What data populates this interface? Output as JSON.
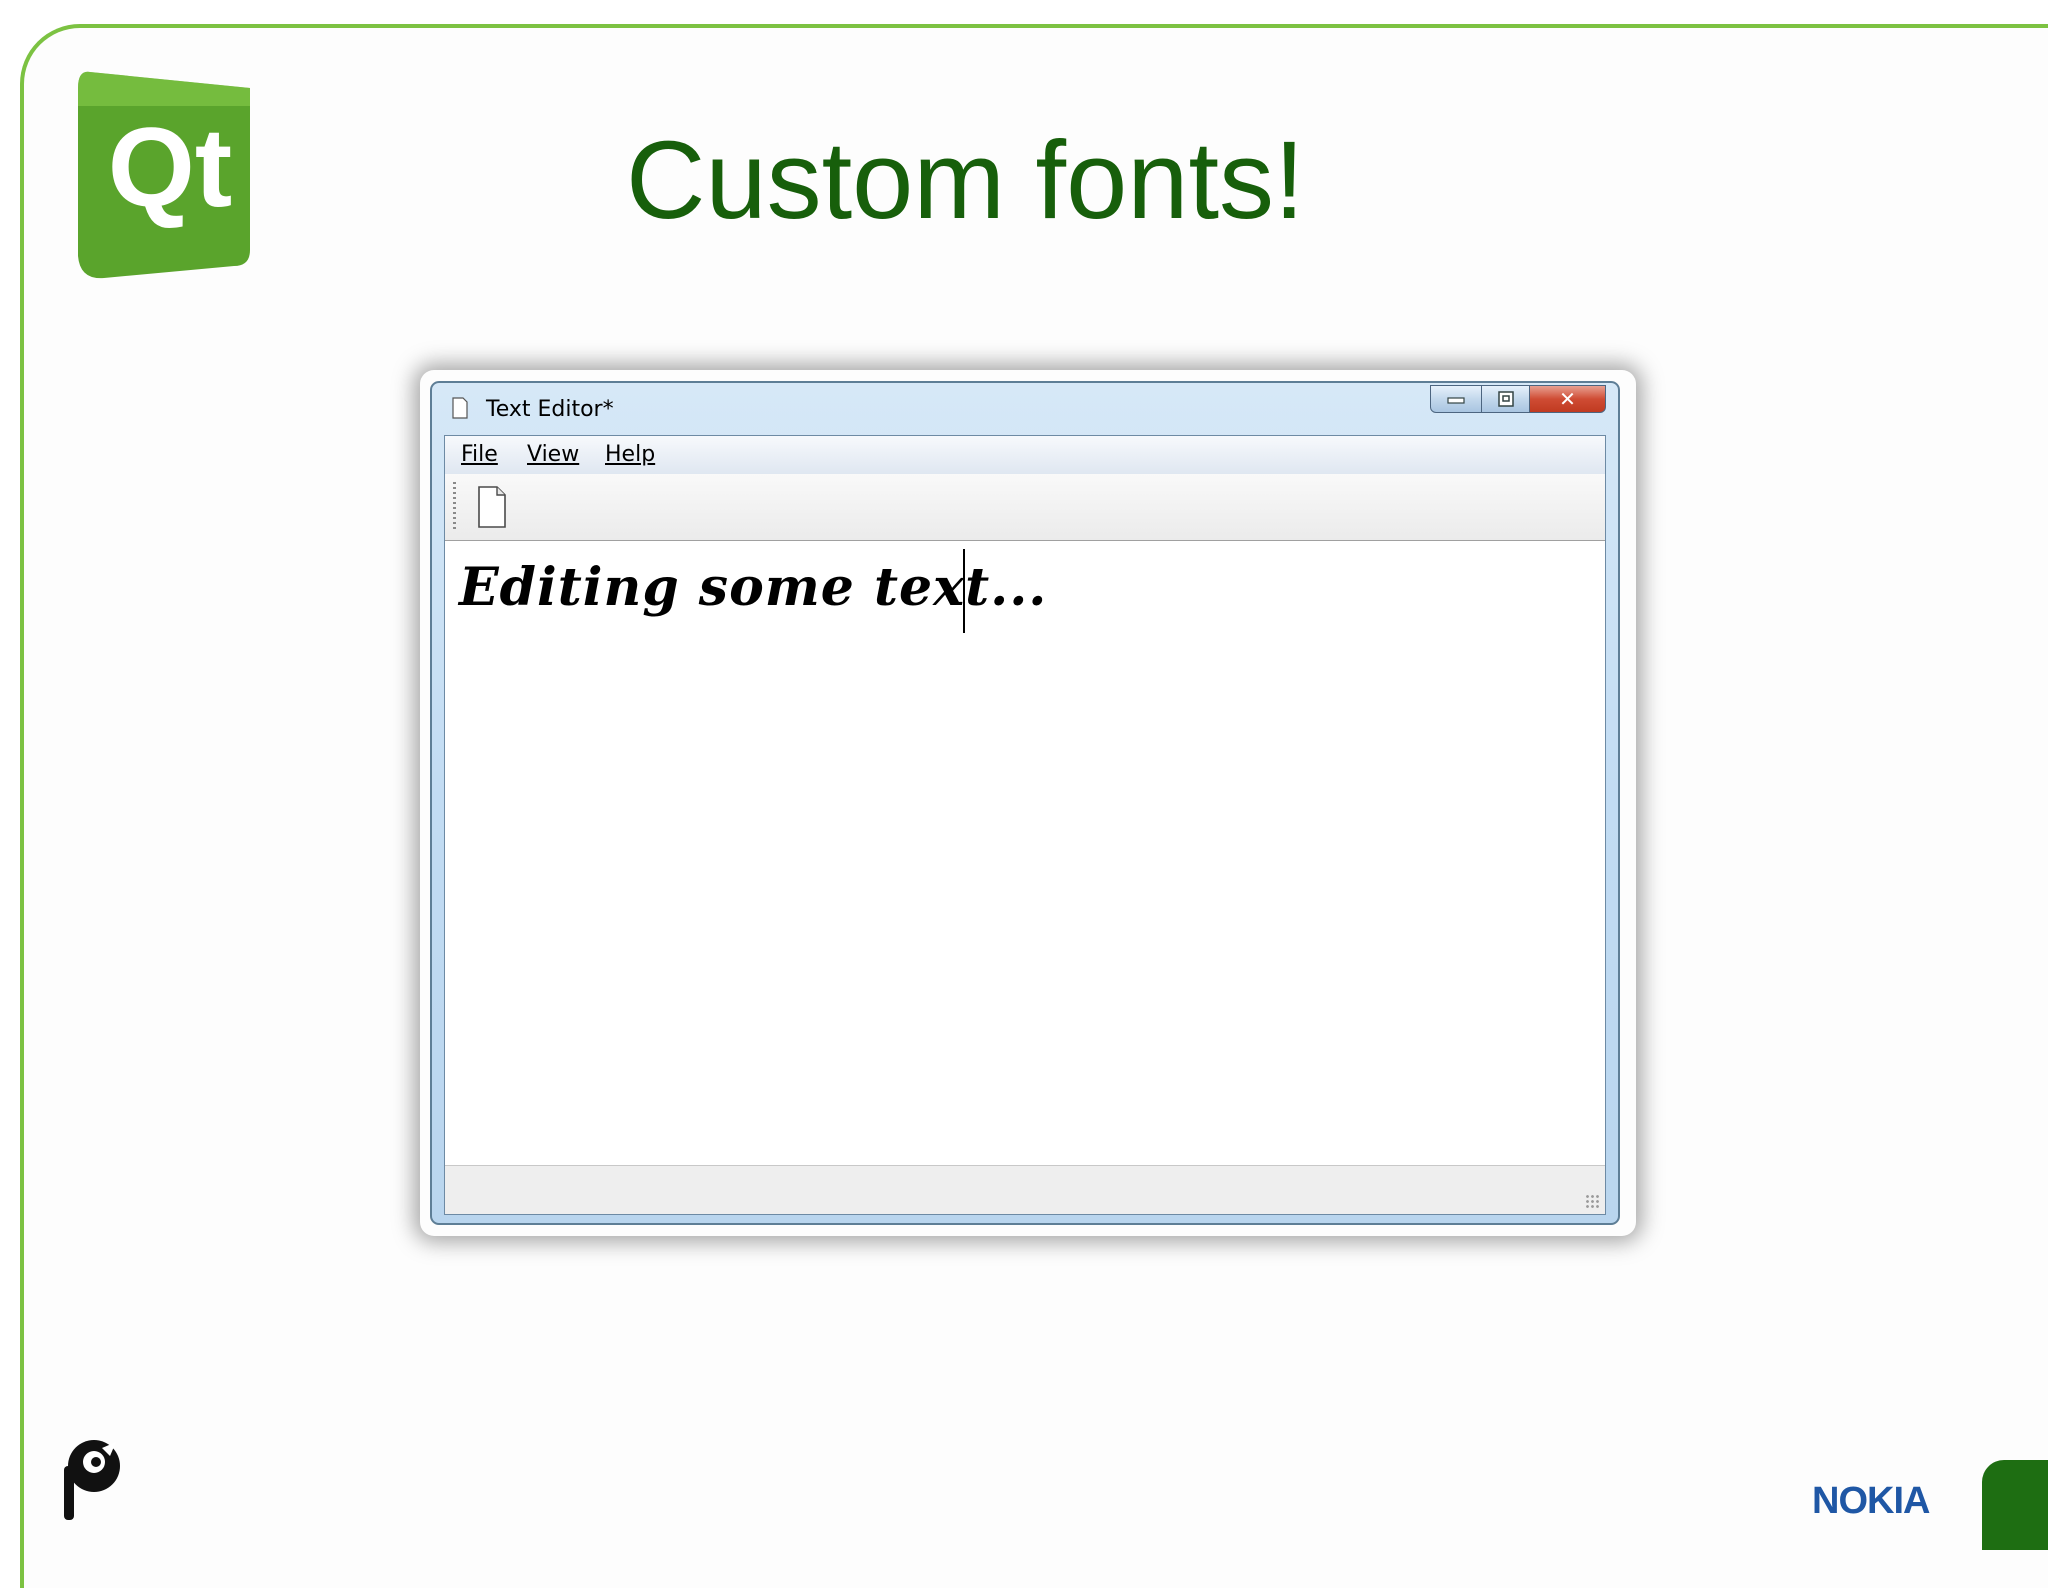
{
  "slide": {
    "title": "Custom fonts!",
    "brand_color": "#175f0b",
    "frame_color": "#7cc242",
    "qt_logo_text": "Qt",
    "footer_logo_text": "NOKIA"
  },
  "window": {
    "title": "Text Editor*",
    "caption_buttons": {
      "minimize": "minimize-icon",
      "maximize": "maximize-icon",
      "close": "close-icon"
    },
    "menu": [
      {
        "label": "File"
      },
      {
        "label": "View"
      },
      {
        "label": "Help"
      }
    ],
    "toolbar": {
      "new_icon": "new-document-icon"
    },
    "editor": {
      "content": "Editing some text..."
    }
  }
}
